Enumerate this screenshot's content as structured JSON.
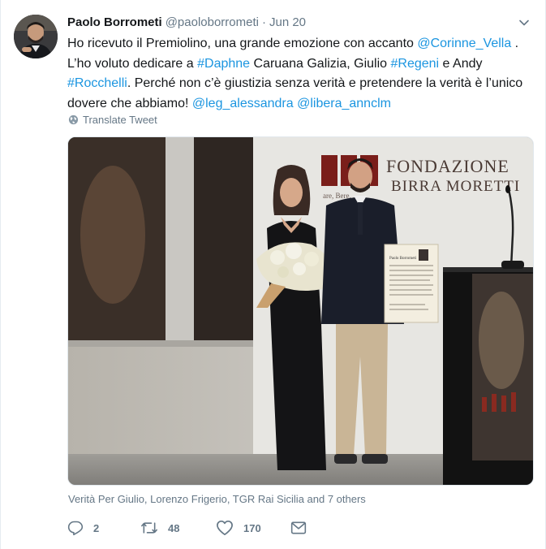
{
  "tweet": {
    "author_name": "Paolo Borrometi",
    "handle": "@paoloborrometi",
    "separator": "·",
    "time": "Jun 20",
    "body": {
      "t1": "Ho ricevuto il Premiolino, una grande emozione con accanto ",
      "mention_corinne": "@Corinne_Vella",
      "t2": " .",
      "t3": "L’ho voluto dedicare a ",
      "hashtag_daphne": "#Daphne",
      "t4": " Caruana Galizia, Giulio ",
      "hashtag_regeni": "#Regeni",
      "t5": " e Andy",
      "hashtag_rocchelli": "#Rocchelli",
      "t6": ". Perché non c’è giustizia senza verità e pretendere la verità è l’unico dovere che abbiamo! ",
      "mention_leg": "@leg_alessandra",
      "t7": " ",
      "mention_libera": "@libera_annclm"
    },
    "translate_label": "Translate Tweet",
    "media": {
      "logo_line1": "FONDAZIONE",
      "logo_line2": "BIRRA MORETTI",
      "logo_tagline": "are, Bere, ...",
      "certificate_heading": "Paolo Borrometi"
    },
    "tagged_people": "Verità Per Giulio, Lorenzo Frigerio, TGR Rai Sicilia and 7 others",
    "actions": {
      "reply_count": "2",
      "retweet_count": "48",
      "like_count": "170"
    }
  }
}
